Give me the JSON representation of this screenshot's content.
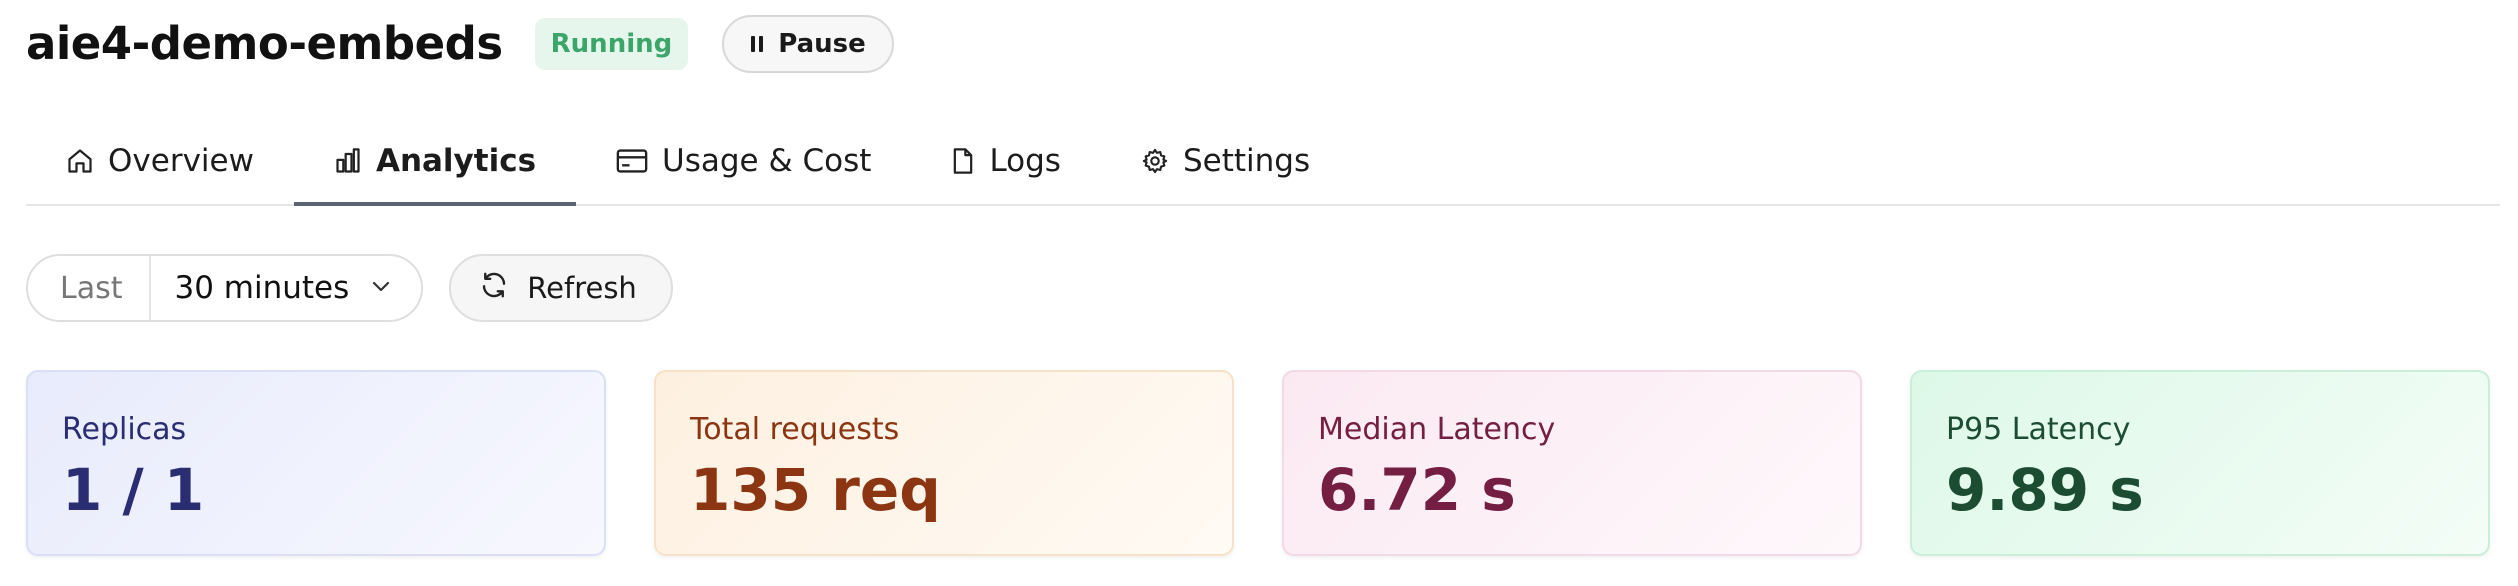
{
  "header": {
    "title": "aie4-demo-embeds",
    "status_badge": "Running",
    "pause_label": "Pause",
    "pause_icon": "pause-icon"
  },
  "tabs": [
    {
      "label": "Overview",
      "icon": "home-icon",
      "active": false
    },
    {
      "label": "Analytics",
      "icon": "bar-chart-icon",
      "active": true
    },
    {
      "label": "Usage & Cost",
      "icon": "credit-card-icon",
      "active": false
    },
    {
      "label": "Logs",
      "icon": "document-icon",
      "active": false
    },
    {
      "label": "Settings",
      "icon": "gear-icon",
      "active": false
    }
  ],
  "controls": {
    "range_prefix": "Last",
    "range_value": "30 minutes",
    "refresh_label": "Refresh"
  },
  "metrics": [
    {
      "label": "Replicas",
      "value": "1 / 1",
      "accent": "#2a2d72"
    },
    {
      "label": "Total requests",
      "value": "135 req",
      "accent": "#8c3512"
    },
    {
      "label": "Median Latency",
      "value": "6.72 s",
      "accent": "#741e43"
    },
    {
      "label": "P95 Latency",
      "value": "9.89 s",
      "accent": "#1c4d33"
    }
  ],
  "colors": {
    "status_badge_bg": "#e6f6ec",
    "status_badge_text": "#3ba56a",
    "active_tab_underline": "#5b6270"
  }
}
